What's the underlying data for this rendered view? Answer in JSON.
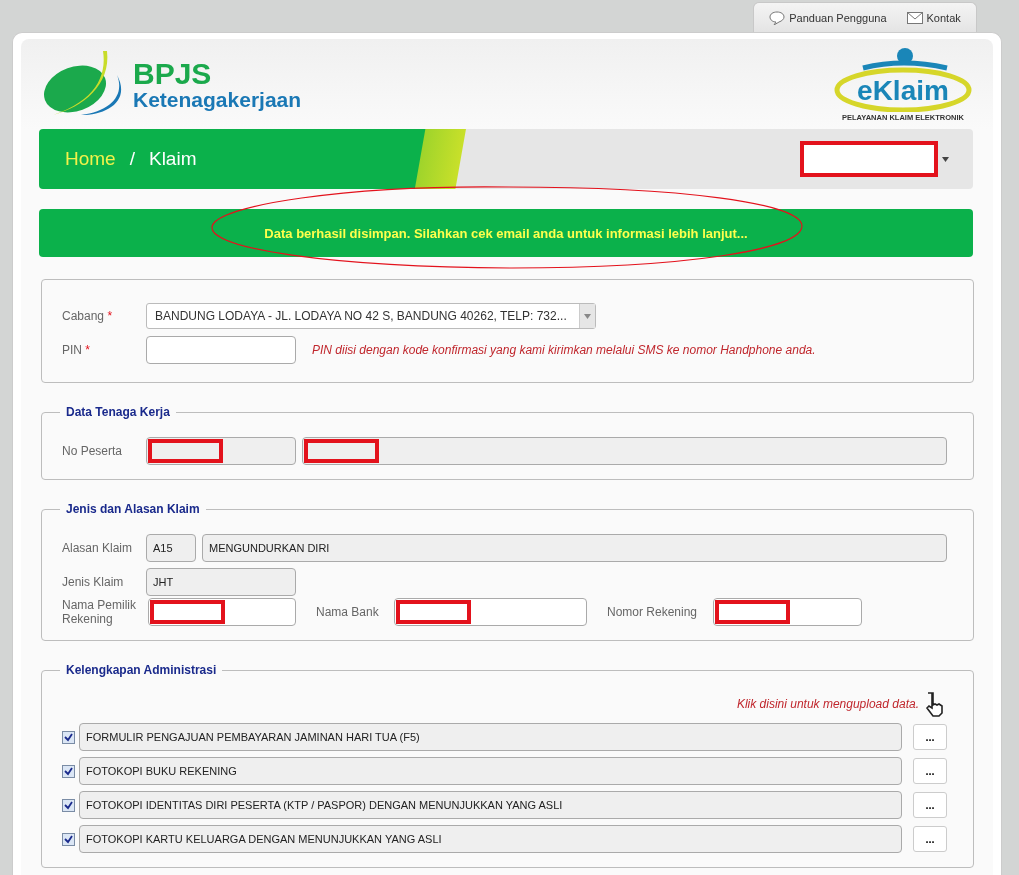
{
  "top_links": [
    {
      "kind": "help",
      "label": "Panduan Pengguna"
    },
    {
      "kind": "mail",
      "label": "Kontak"
    }
  ],
  "header": {
    "brand_line_1": "BPJS",
    "brand_line_2": "Ketenagakerjaan",
    "app_name": "eKlaim",
    "app_tagline": "PELAYANAN KLAIM ELEKTRONIK"
  },
  "breadcrumb": [
    {
      "label": "Home",
      "selected": false
    },
    {
      "label": "Klaim",
      "selected": true
    }
  ],
  "breadcrumb_separator": "/",
  "user_menu": {
    "redacted": true
  },
  "message": {
    "text": "Data berhasil disimpan. Silahkan cek email anda untuk informasi lebih lanjut...",
    "circled": true
  },
  "cabang": {
    "label": "Cabang",
    "required_mark": "*",
    "value": "BANDUNG LODAYA - JL. LODAYA NO 42 S, BANDUNG 40262, TELP: 732..."
  },
  "pin": {
    "label": "PIN",
    "required_mark": "*",
    "hint": "PIN diisi dengan kode konfirmasi yang kami kirimkan melalui SMS ke nomor Handphone anda."
  },
  "data_tenaga_kerja": {
    "title": "Data Tenaga Kerja",
    "label": "No Peserta",
    "fields": [
      {
        "redacted": true
      },
      {
        "redacted": true
      }
    ]
  },
  "jenis_alasan": {
    "title": "Jenis dan Alasan Klaim",
    "alasan": {
      "label": "Alasan Klaim",
      "code": "A15",
      "value": "MENGUNDURKAN DIRI"
    },
    "jenis": {
      "label": "Jenis Klaim",
      "value": "JHT"
    },
    "bank_fields": [
      {
        "label": "Nama Pemilik Rekening",
        "redacted": true
      },
      {
        "label": "Nama Bank",
        "redacted": true
      },
      {
        "label": "Nomor Rekening",
        "redacted": true
      }
    ]
  },
  "kelengkapan": {
    "title": "Kelengkapan Administrasi",
    "upload_hint": "Klik disini untuk mengupload data.",
    "documents": [
      {
        "name": "FORMULIR PENGAJUAN PEMBAYARAN JAMINAN HARI TUA (F5)",
        "checked": true,
        "button": "..."
      },
      {
        "name": "FOTOKOPI BUKU REKENING",
        "checked": true,
        "button": "..."
      },
      {
        "name": "FOTOKOPI IDENTITAS DIRI PESERTA (KTP / PASPOR) DENGAN MENUNJUKKAN YANG ASLI",
        "checked": true,
        "button": "..."
      },
      {
        "name": "FOTOKOPI KARTU KELUARGA DENGAN MENUNJUKKAN YANG ASLI",
        "checked": true,
        "button": "..."
      }
    ]
  }
}
